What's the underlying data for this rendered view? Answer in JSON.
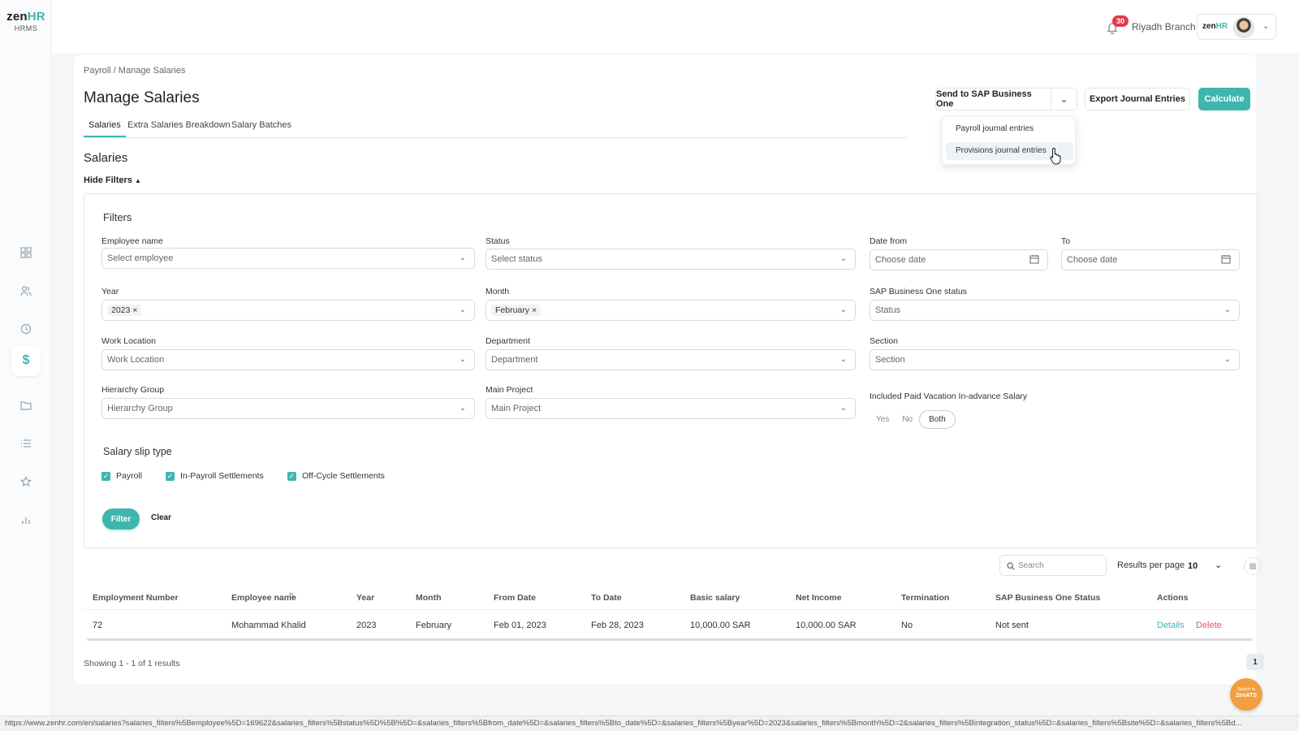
{
  "logo": {
    "brand_a": "zen",
    "brand_b": "HR",
    "sub": "HRMS"
  },
  "nav": {
    "items": [
      {
        "name": "dashboard",
        "icon": "grid-icon"
      },
      {
        "name": "employees",
        "icon": "users-icon"
      },
      {
        "name": "attendance",
        "icon": "clock-icon"
      },
      {
        "name": "payroll",
        "icon": "dollar-icon",
        "active": true
      },
      {
        "name": "documents",
        "icon": "folder-icon"
      },
      {
        "name": "lists",
        "icon": "list-icon"
      },
      {
        "name": "favorites",
        "icon": "star-icon"
      },
      {
        "name": "reports",
        "icon": "bar-chart-icon"
      }
    ]
  },
  "topbar": {
    "notification_count": "30",
    "branch": "Riyadh Branch",
    "user_logo_a": "zen",
    "user_logo_b": "HR"
  },
  "breadcrumb": {
    "parent": "Payroll",
    "separator": " / ",
    "current": "Manage Salaries"
  },
  "page_title": "Manage Salaries",
  "tabs": [
    {
      "label": "Salaries",
      "active": true
    },
    {
      "label": "Extra Salaries Breakdown"
    },
    {
      "label": "Salary Batches"
    }
  ],
  "actions": {
    "send_sap": "Send to SAP Business One",
    "export": "Export Journal Entries",
    "calculate": "Calculate"
  },
  "dropdown": {
    "items": [
      "Payroll journal entries",
      "Provisions journal entries"
    ],
    "hovered_index": 1
  },
  "section_title": "Salaries",
  "hide_filters": "Hide Filters",
  "filters": {
    "title": "Filters",
    "employee_name": {
      "label": "Employee name",
      "placeholder": "Select employee"
    },
    "status": {
      "label": "Status",
      "placeholder": "Select status"
    },
    "date_from": {
      "label": "Date from",
      "placeholder": "Choose date"
    },
    "date_to": {
      "label": "To",
      "placeholder": "Choose date"
    },
    "year": {
      "label": "Year",
      "value": "2023"
    },
    "month": {
      "label": "Month",
      "value": "February"
    },
    "sap_status": {
      "label": "SAP Business One status",
      "placeholder": "Status"
    },
    "work_location": {
      "label": "Work Location",
      "placeholder": "Work Location"
    },
    "department": {
      "label": "Department",
      "placeholder": "Department"
    },
    "section": {
      "label": "Section",
      "placeholder": "Section"
    },
    "hierarchy_group": {
      "label": "Hierarchy Group",
      "placeholder": "Hierarchy Group"
    },
    "main_project": {
      "label": "Main Project",
      "placeholder": "Main Project"
    },
    "paid_vacation": {
      "label": "Included Paid Vacation In-advance Salary",
      "options": [
        "Yes",
        "No",
        "Both"
      ],
      "selected": "Both"
    },
    "slip_type": {
      "title": "Salary slip type",
      "options": [
        {
          "label": "Payroll",
          "checked": true
        },
        {
          "label": "In-Payroll Settlements",
          "checked": true
        },
        {
          "label": "Off-Cycle Settlements",
          "checked": true
        }
      ]
    },
    "filter_btn": "Filter",
    "clear_btn": "Clear"
  },
  "table_controls": {
    "search_placeholder": "Search",
    "results_per_page_label": "Results per page",
    "results_per_page_value": "10"
  },
  "table": {
    "headers": [
      "Employment Number",
      "Employee name",
      "Year",
      "Month",
      "From Date",
      "To Date",
      "Basic salary",
      "Net Income",
      "Termination",
      "SAP Business One Status",
      "Actions"
    ],
    "rows": [
      {
        "employment_number": "72",
        "employee_name": "Mohammad Khalid",
        "year": "2023",
        "month": "February",
        "from_date": "Feb 01, 2023",
        "to_date": "Feb 28, 2023",
        "basic_salary": "10,000.00 SAR",
        "net_income": "10,000.00 SAR",
        "termination": "No",
        "sap_status": "Not sent",
        "action_details": "Details",
        "action_delete": "Delete"
      }
    ]
  },
  "pagination": {
    "showing": "Showing 1 - 1 of 1 results",
    "current_page": "1"
  },
  "zenats": {
    "line1": "Switch to",
    "line2": "ZenATS"
  },
  "status_url": "https://www.zenhr.com/en/salaries?salaries_filters%5Bemployee%5D=169622&salaries_filters%5Bstatus%5D%5B%5D=&salaries_filters%5Bfrom_date%5D=&salaries_filters%5Bto_date%5D=&salaries_filters%5Byear%5D=2023&salaries_filters%5Bmonth%5D=2&salaries_filters%5Bintegration_status%5D=&salaries_filters%5Bsite%5D=&salaries_filters%5Bd...",
  "colors": {
    "accent": "#3fb5b0",
    "danger": "#e05565",
    "badge": "#e53950",
    "zenats": "#f0a040"
  }
}
